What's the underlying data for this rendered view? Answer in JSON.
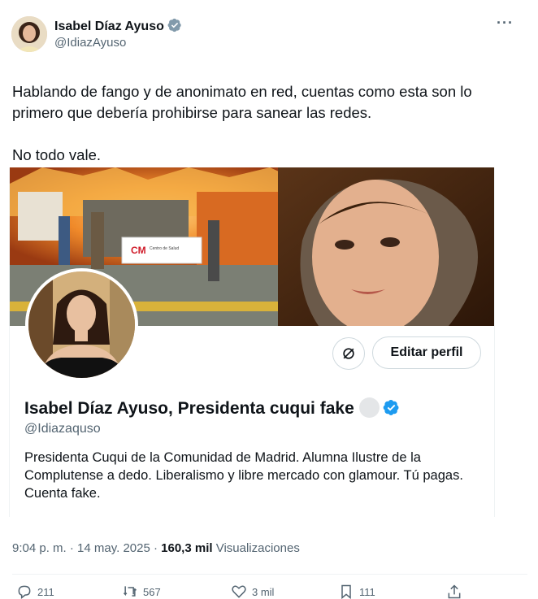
{
  "tweet": {
    "author_name": "Isabel Díaz Ayuso",
    "author_handle": "@IdiazAyuso",
    "text_line1": "Hablando de fango y de anonimato en red, cuentas como esta son lo primero que debería prohibirse para sanear las redes.",
    "text_line2": "No todo vale.",
    "timestamp": "9:04 p. m. · 14 may. 2025 · ",
    "views_count": "160,3 mil",
    "views_label": "Visualizaciones"
  },
  "embedded_profile": {
    "banner_sign_logo": "CM",
    "banner_sign_text": "Centro de Salud",
    "edit_button_label": "Editar perfil",
    "display_name": "Isabel Díaz Ayuso, Presidenta cuqui fake",
    "handle": "@Idiazaquso",
    "bio": "Presidenta Cuqui de la Comunidad de Madrid. Alumna Ilustre de la Complutense a dedo. Liberalismo y libre mercado con glamour. Tú pagas. Cuenta fake."
  },
  "actions": {
    "replies": "211",
    "retweets": "567",
    "likes": "3 mil",
    "bookmarks": "111"
  },
  "colors": {
    "accent": "#1d9bf0",
    "text_primary": "#0f1419",
    "text_secondary": "#536471",
    "border": "#cfd9de"
  },
  "icons": [
    "verified-badge-icon",
    "more-icon",
    "link-icon",
    "reply-icon",
    "retweet-icon",
    "like-icon",
    "bookmark-icon",
    "share-icon"
  ]
}
